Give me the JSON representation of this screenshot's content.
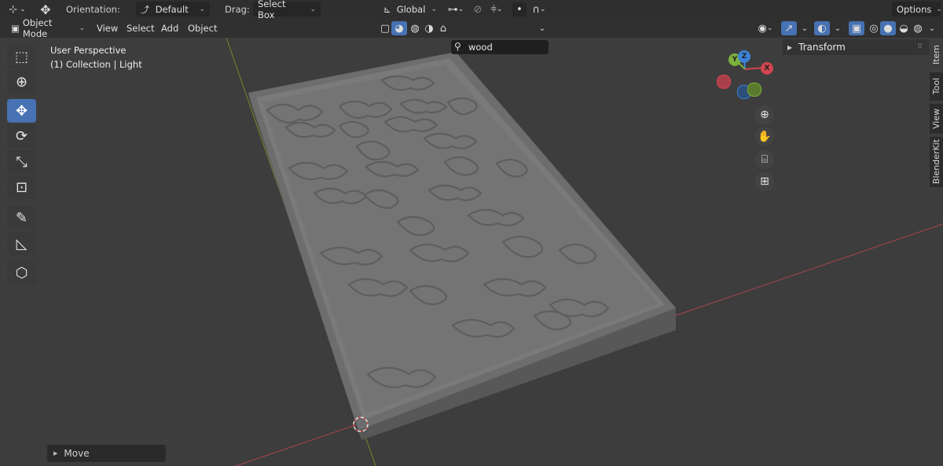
{
  "header": {
    "orientation_label": "Orientation:",
    "orientation_value": "Default",
    "drag_label": "Drag:",
    "drag_value": "Select Box",
    "transform_space": "Global",
    "options_label": "Options"
  },
  "menu": {
    "mode": "Object Mode",
    "items": [
      "View",
      "Select",
      "Add",
      "Object"
    ]
  },
  "shading_search": {
    "value": "wood"
  },
  "viewport": {
    "perspective": "User Perspective",
    "collection": "(1) Collection | Light"
  },
  "gizmo": {
    "x": "X",
    "y": "Y",
    "z": "Z"
  },
  "sidebar": {
    "panel_title": "Transform",
    "tabs": [
      "Item",
      "Tool",
      "View",
      "BlenderKit"
    ],
    "active_tab": "Item"
  },
  "last_operator": "Move",
  "colors": {
    "accent": "#4772b3",
    "x_axis": "#d0454f",
    "y_axis": "#7ab03b",
    "z_axis": "#3b82d6"
  }
}
